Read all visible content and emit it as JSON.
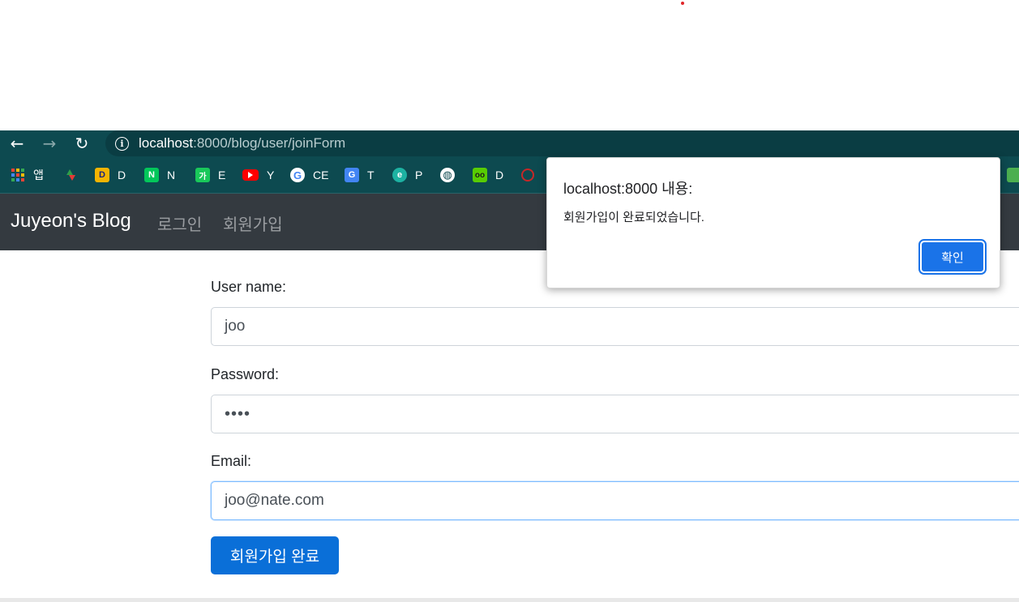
{
  "browser": {
    "url_host": "localhost",
    "url_path": ":8000/blog/user/joinForm",
    "bookmarks": [
      {
        "label": "앱",
        "icon": "apps-grid-icon",
        "color": "#e0e0e0"
      },
      {
        "label": "",
        "icon": "stock-arrows-icon",
        "color": "#2e9e4a"
      },
      {
        "label": "D",
        "icon": "d-logo-icon",
        "color": "#f4b400"
      },
      {
        "label": "N",
        "icon": "naver-icon",
        "color": "#03c75a"
      },
      {
        "label": "E",
        "icon": "korean-dict-icon",
        "color": "#19c85a"
      },
      {
        "label": "Y",
        "icon": "youtube-icon",
        "color": "#ff0000"
      },
      {
        "label": "CE",
        "icon": "google-icon",
        "color": "#ffffff"
      },
      {
        "label": "T",
        "icon": "translate-icon",
        "color": "#4285f4"
      },
      {
        "label": "P",
        "icon": "edge-icon",
        "color": "#1db2a2"
      },
      {
        "label": "",
        "icon": "globe-icon",
        "color": "#ffffff"
      },
      {
        "label": "D",
        "icon": "duolingo-icon",
        "color": "#58cc02"
      },
      {
        "label": "",
        "icon": "red-logo-icon",
        "color": "#c62828"
      }
    ]
  },
  "navbar": {
    "brand": "Juyeon's Blog",
    "links": [
      "로그인",
      "회원가입"
    ]
  },
  "form": {
    "username_label": "User name:",
    "username_value": "joo",
    "password_label": "Password:",
    "password_value": "••••",
    "email_label": "Email:",
    "email_value": "joo@nate.com",
    "submit_label": "회원가입 완료"
  },
  "dialog": {
    "title": "localhost:8000 내용:",
    "message": "회원가입이 완료되었습니다.",
    "ok_label": "확인",
    "ok_color": "#1a73e8"
  }
}
